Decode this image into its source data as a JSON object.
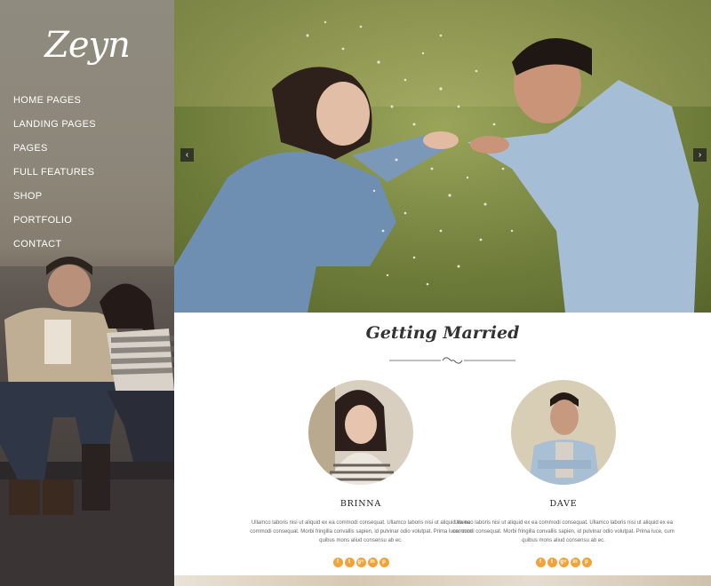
{
  "sidebar": {
    "logo": "Zeyn",
    "nav": [
      {
        "label": "HOME PAGES"
      },
      {
        "label": "LANDING PAGES"
      },
      {
        "label": "PAGES"
      },
      {
        "label": "FULL FEATURES"
      },
      {
        "label": "SHOP"
      },
      {
        "label": "PORTFOLIO"
      },
      {
        "label": "CONTACT"
      }
    ]
  },
  "hero": {
    "prev_icon": "chevron-left-icon",
    "next_icon": "chevron-right-icon"
  },
  "section": {
    "title": "Getting Married"
  },
  "people": [
    {
      "name": "BRINNA",
      "bio": "Ullamco laboris nisi ut aliquid ex ea commodi consequat. Ullamco laboris nisi ut aliquid ex ea commodi consequat. Morbi fringilla convallis sapien, id pulvinar odio volutpat. Prima luce, cum quibus mons aliud consensu ab ec.",
      "socials": [
        "facebook-icon",
        "twitter-icon",
        "google-plus-icon",
        "linkedin-icon",
        "pinterest-icon"
      ]
    },
    {
      "name": "DAVE",
      "bio": "Ullamco laboris nisi ut aliquid ex ea commodi consequat. Ullamco laboris nisi ut aliquid ex ea commodi consequat. Morbi fringilla convallis sapien, id pulvinar odio volutpat. Prima luce, cum quibus mons aliud consensu ab ec.",
      "socials": [
        "facebook-icon",
        "twitter-icon",
        "google-plus-icon",
        "linkedin-icon",
        "pinterest-icon"
      ]
    }
  ],
  "colors": {
    "accent": "#f0a33a",
    "sidebar": "#8c8679"
  }
}
